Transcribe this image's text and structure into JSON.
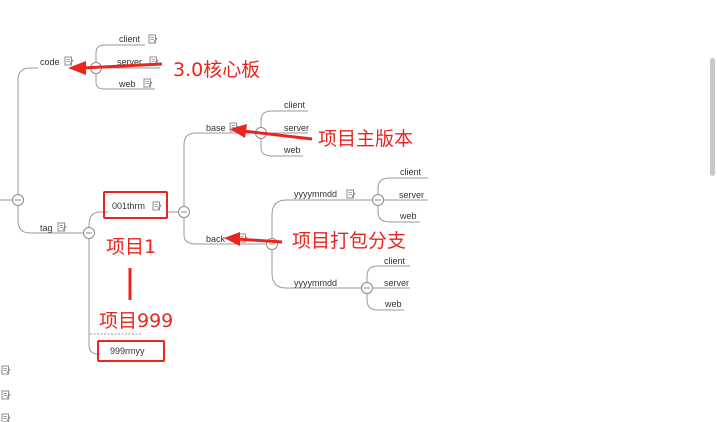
{
  "colors": {
    "line": "#9a9a9a",
    "text": "#333333",
    "accent": "#e8251f",
    "icon": "#8f8f8f"
  },
  "nodes": {
    "code": "code",
    "code_client": "client",
    "code_server": "server",
    "code_web": "web",
    "tag": "tag",
    "thrm": "001thrm",
    "base": "base",
    "base_client": "client",
    "base_server": "server",
    "base_web": "web",
    "back": "back",
    "yyyy1": "yyyymmdd",
    "y1_client": "client",
    "y1_server": "server",
    "y1_web": "web",
    "yyyy2": "yyyymmdd",
    "y2_client": "client",
    "y2_server": "server",
    "y2_web": "web",
    "rmyy": "999rmyy"
  },
  "annotations": {
    "core_board": "3.0核心板",
    "main_version": "项目主版本",
    "branch": "项目打包分支",
    "project1": "项目1",
    "project999": "项目999"
  },
  "icons": {
    "note": "note-icon",
    "collapse": "collapse-toggle-icon"
  }
}
